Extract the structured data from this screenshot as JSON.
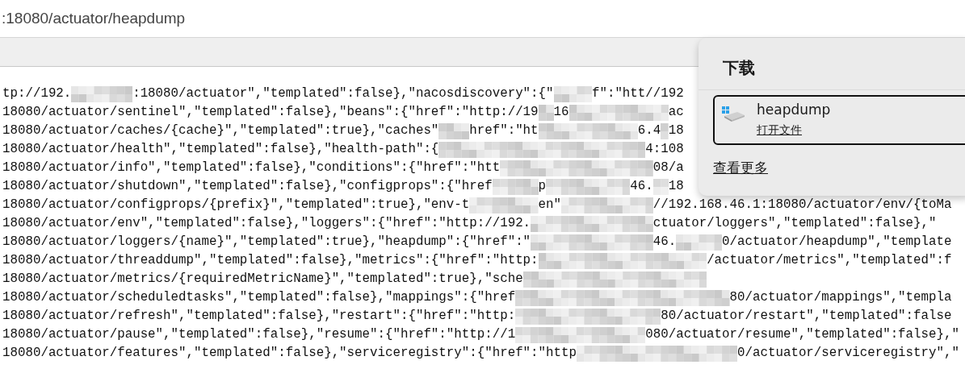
{
  "address_bar": {
    "url": ":18080/actuator/heapdump"
  },
  "content_lines": [
    {
      "parts": [
        "tp://192.",
        ":18080/actuator\",\"templated\":false},\"nacosdiscovery\":{\"",
        "f\":\"htt",
        "//192"
      ]
    },
    {
      "parts": [
        "18080/actuator/sentinel\",\"templated\":false},\"beans\":{\"href\":\"http://19",
        "16",
        "ac"
      ]
    },
    {
      "parts": [
        "18080/actuator/caches/{cache}\",\"templated\":true},\"caches\"",
        "href\":\"ht",
        "6.4",
        "18"
      ]
    },
    {
      "parts": [
        "18080/actuator/health\",\"templated\":false},\"health-path\":{",
        "4:1",
        "08"
      ]
    },
    {
      "parts": [
        "18080/actuator/info\",\"templated\":false},\"conditions\":{\"href\":\"htt",
        "08/a"
      ]
    },
    {
      "parts": [
        "18080/actuator/shutdown\",\"templated\":false},\"configprops\":{\"href",
        "p",
        "46.",
        "18"
      ]
    },
    {
      "parts": [
        "18080/actuator/configprops/{prefix}\",\"templated\":true},\"env-t",
        "en\"",
        "//192.168.46.1:18080/actuator/env/{toMa"
      ]
    },
    {
      "parts": [
        "18080/actuator/env\",\"templated\":false},\"loggers\":{\"href\":\"http://192.",
        "ctuator/loggers\",\"templated\":false},\""
      ]
    },
    {
      "parts": [
        "18080/actuator/loggers/{name}\",\"templated\":true},\"heapdump\":{\"href\":\"",
        "46.",
        "0/actuator/heapdump\",\"template"
      ]
    },
    {
      "parts": [
        "18080/actuator/threaddump\",\"templated\":false},\"metrics\":{\"href\":\"http:",
        "/actuator/metrics\",\"templated\":f"
      ]
    },
    {
      "parts": [
        "18080/actuator/metrics/{requiredMetricName}\",\"templated\":true},\"sche"
      ]
    },
    {
      "parts": [
        "18080/actuator/scheduledtasks\",\"templated\":false},\"mappings\":{\"href",
        "80/actuator/mappings\",\"templa"
      ]
    },
    {
      "parts": [
        "18080/actuator/refresh\",\"templated\":false},\"restart\":{\"href\":\"http:",
        "80/actuator/restart\",\"templated\":false"
      ]
    },
    {
      "parts": [
        "18080/actuator/pause\",\"templated\":false},\"resume\":{\"href\":\"http://1",
        "080/actuator/resume\",\"templated\":false},\""
      ]
    },
    {
      "parts": [
        "18080/actuator/features\",\"templated\":false},\"serviceregistry\":{\"href\":\"http",
        "0/actuator/serviceregistry\",\""
      ]
    }
  ],
  "downloads_panel": {
    "title": "下载",
    "items": [
      {
        "name": "heapdump",
        "action": "打开文件",
        "selected": true
      }
    ],
    "see_more": "查看更多"
  }
}
